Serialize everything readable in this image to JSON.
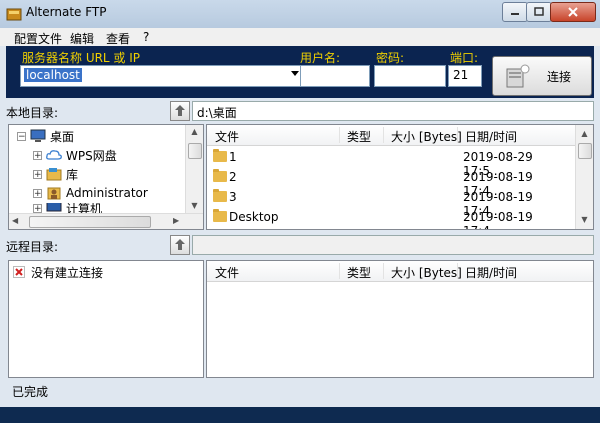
{
  "window": {
    "title": "Alternate FTP"
  },
  "menu": [
    "配置文件",
    "编辑",
    "查看",
    "?"
  ],
  "connection": {
    "host_label": "服务器名称 URL 或 IP",
    "host_value": "localhost",
    "user_label": "用户名:",
    "user_value": "",
    "pass_label": "密码:",
    "pass_value": "",
    "port_label": "端口:",
    "port_value": "21",
    "connect_label": "连接"
  },
  "local": {
    "label": "本地目录:",
    "path": "d:\\桌面",
    "tree": [
      {
        "label": "桌面",
        "icon": "desktop-icon"
      },
      {
        "label": "WPS网盘",
        "icon": "cloud-icon"
      },
      {
        "label": "库",
        "icon": "library-icon"
      },
      {
        "label": "Administrator",
        "icon": "user-icon"
      },
      {
        "label": "计算机",
        "icon": "computer-icon"
      }
    ],
    "columns": [
      "文件",
      "类型",
      "大小 [Bytes]",
      "日期/时间"
    ],
    "files": [
      {
        "name": "1",
        "date": "2019-08-29 17:5..."
      },
      {
        "name": "2",
        "date": "2019-08-19 17:4..."
      },
      {
        "name": "3",
        "date": "2019-08-19 17:4..."
      },
      {
        "name": "Desktop",
        "date": "2019-08-19 17:4..."
      }
    ]
  },
  "remote": {
    "label": "远程目录:",
    "path": "",
    "status_text": "没有建立连接",
    "columns": [
      "文件",
      "类型",
      "大小 [Bytes]",
      "日期/时间"
    ]
  },
  "status": "已完成",
  "colors": {
    "label_yellow": "#f0d000",
    "conn_bar": "#0b2450",
    "selection": "#3a73c9"
  }
}
